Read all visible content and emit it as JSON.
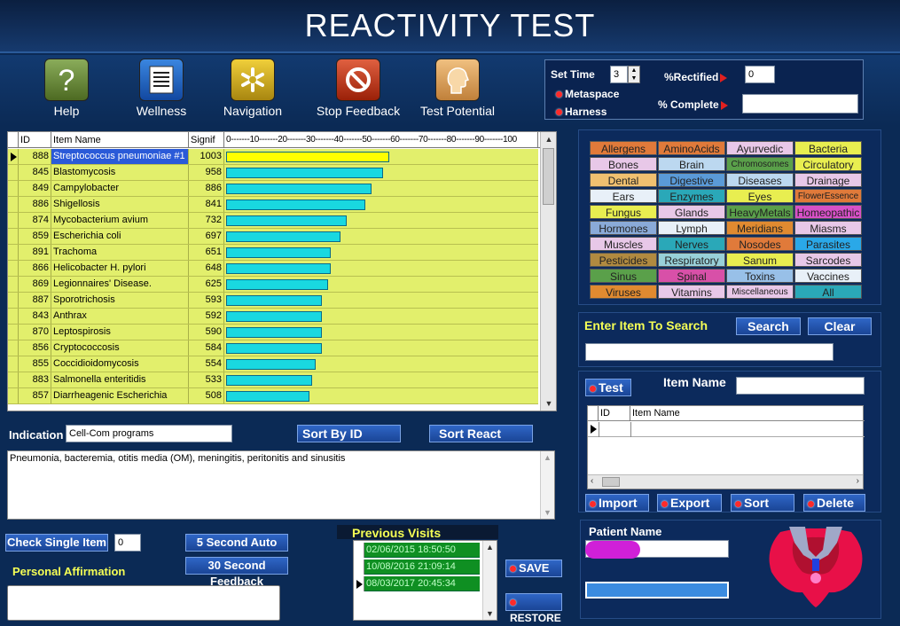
{
  "header": {
    "title": "REACTIVITY TEST"
  },
  "toolbar": [
    {
      "label": "Help",
      "icon": "question-icon",
      "color": "#6a8a3a"
    },
    {
      "label": "Wellness",
      "icon": "list-icon",
      "color": "#1d5fb8"
    },
    {
      "label": "Navigation",
      "icon": "asterisk-icon",
      "color": "#c8a81e"
    },
    {
      "label": "Stop Feedback",
      "icon": "stop-icon",
      "color": "#c43a1a"
    },
    {
      "label": "Test Potential",
      "icon": "head-icon",
      "color": "#d49a4a"
    }
  ],
  "settings": {
    "set_time_label": "Set Time",
    "set_time_value": "3",
    "metaspace_label": "Metaspace",
    "harness_label": "Harness",
    "rectified_label": "%Rectified",
    "rectified_value": "0",
    "complete_label": "% Complete",
    "complete_value": ""
  },
  "grid": {
    "columns": [
      "ID",
      "Item Name",
      "Signif",
      "0-------10-------20-------30-------40-------50-------60-------70-------80-------90-------100"
    ],
    "rows": [
      {
        "id": "888",
        "name": "Streptococcus pneumoniae #1",
        "signif": "1003",
        "pct": 53,
        "bar_color": "#ffff00",
        "selected": true
      },
      {
        "id": "845",
        "name": "Blastomycosis",
        "signif": "958",
        "pct": 51,
        "bar_color": "#19d8e0"
      },
      {
        "id": "849",
        "name": "Campylobacter",
        "signif": "886",
        "pct": 47,
        "bar_color": "#19d8e0"
      },
      {
        "id": "886",
        "name": "Shigellosis",
        "signif": "841",
        "pct": 45,
        "bar_color": "#19d8e0"
      },
      {
        "id": "874",
        "name": "Mycobacterium avium",
        "signif": "732",
        "pct": 39,
        "bar_color": "#19d8e0"
      },
      {
        "id": "859",
        "name": "Escherichia coli",
        "signif": "697",
        "pct": 37,
        "bar_color": "#19d8e0"
      },
      {
        "id": "891",
        "name": "Trachoma",
        "signif": "651",
        "pct": 34,
        "bar_color": "#19d8e0"
      },
      {
        "id": "866",
        "name": "Helicobacter H. pylori",
        "signif": "648",
        "pct": 34,
        "bar_color": "#19d8e0"
      },
      {
        "id": "869",
        "name": "Legionnaires' Disease.",
        "signif": "625",
        "pct": 33,
        "bar_color": "#19d8e0"
      },
      {
        "id": "887",
        "name": "Sporotrichosis",
        "signif": "593",
        "pct": 31,
        "bar_color": "#19d8e0"
      },
      {
        "id": "843",
        "name": "Anthrax",
        "signif": "592",
        "pct": 31,
        "bar_color": "#19d8e0"
      },
      {
        "id": "870",
        "name": "Leptospirosis",
        "signif": "590",
        "pct": 31,
        "bar_color": "#19d8e0"
      },
      {
        "id": "856",
        "name": "Cryptococcosis",
        "signif": "584",
        "pct": 31,
        "bar_color": "#19d8e0"
      },
      {
        "id": "855",
        "name": "Coccidioidomycosis",
        "signif": "554",
        "pct": 29,
        "bar_color": "#19d8e0"
      },
      {
        "id": "883",
        "name": "Salmonella enteritidis",
        "signif": "533",
        "pct": 28,
        "bar_color": "#19d8e0"
      },
      {
        "id": "857",
        "name": "Diarrheagenic Escherichia",
        "signif": "508",
        "pct": 27,
        "bar_color": "#19d8e0"
      }
    ]
  },
  "categories": [
    {
      "label": "Allergens",
      "color": "#e07a3a"
    },
    {
      "label": "AminoAcids",
      "color": "#e07a3a"
    },
    {
      "label": "Ayurvedic",
      "color": "#e8c8e8"
    },
    {
      "label": "Bacteria",
      "color": "#e8ee50"
    },
    {
      "label": "Bones",
      "color": "#e8c8e8"
    },
    {
      "label": "Brain",
      "color": "#bcd8f0"
    },
    {
      "label": "Chromosomes",
      "color": "#5aa04a"
    },
    {
      "label": "Circulatory",
      "color": "#e8ee50"
    },
    {
      "label": "Dental",
      "color": "#f0c070"
    },
    {
      "label": "Digestive",
      "color": "#5a9ad8"
    },
    {
      "label": "Diseases",
      "color": "#bcd8f0"
    },
    {
      "label": "Drainage",
      "color": "#e8c8e8"
    },
    {
      "label": "Ears",
      "color": "#e8f0f8"
    },
    {
      "label": "Enzymes",
      "color": "#2aa8b8"
    },
    {
      "label": "Eyes",
      "color": "#e8ee50"
    },
    {
      "label": "FlowerEssence",
      "color": "#e07a3a"
    },
    {
      "label": "Fungus",
      "color": "#e8ee50"
    },
    {
      "label": "Glands",
      "color": "#e8c8e8"
    },
    {
      "label": "HeavyMetals",
      "color": "#5aa04a"
    },
    {
      "label": "Homeopathic",
      "color": "#d850c8"
    },
    {
      "label": "Hormones",
      "color": "#8aaad8"
    },
    {
      "label": "Lymph",
      "color": "#e8f0f8"
    },
    {
      "label": "Meridians",
      "color": "#e08a30"
    },
    {
      "label": "Miasms",
      "color": "#e8c8e8"
    },
    {
      "label": "Muscles",
      "color": "#e8c8e8"
    },
    {
      "label": "Nerves",
      "color": "#2aa8b8"
    },
    {
      "label": "Nosodes",
      "color": "#e07a3a"
    },
    {
      "label": "Parasites",
      "color": "#2aa8e8"
    },
    {
      "label": "Pesticides",
      "color": "#b08a40"
    },
    {
      "label": "Respiratory",
      "color": "#98d0d8"
    },
    {
      "label": "Sanum",
      "color": "#e8ee50"
    },
    {
      "label": "Sarcodes",
      "color": "#e8c8e8"
    },
    {
      "label": "Sinus",
      "color": "#5aa04a"
    },
    {
      "label": "Spinal",
      "color": "#d850a8"
    },
    {
      "label": "Toxins",
      "color": "#98c0e8"
    },
    {
      "label": "Vaccines",
      "color": "#e8f0f8"
    },
    {
      "label": "Viruses",
      "color": "#e08a30"
    },
    {
      "label": "Vitamins",
      "color": "#e8c8e8"
    },
    {
      "label": "Miscellaneous",
      "color": "#e8c8e8"
    },
    {
      "label": "All",
      "color": "#2aa8b8"
    }
  ],
  "search": {
    "label": "Enter Item To Search",
    "search_btn": "Search",
    "clear_btn": "Clear",
    "value": ""
  },
  "test_panel": {
    "test_btn": "Test",
    "item_name_label": "Item Name",
    "item_name_value": "",
    "columns": [
      "ID",
      "Item Name"
    ],
    "import_btn": "Import",
    "export_btn": "Export",
    "sort_btn": "Sort",
    "delete_btn": "Delete"
  },
  "indication": {
    "label": "Indication",
    "value": "Cell-Com programs",
    "sort_id_btn": "Sort  By  ID",
    "sort_react_btn": "Sort React",
    "description": "Pneumonia, bacteremia, otitis media (OM), meningitis, peritonitis and sinusitis"
  },
  "bottom": {
    "check_single_btn": "Check Single Item",
    "check_single_value": "0",
    "five_sec_btn": "5 Second Auto",
    "thirty_sec_btn": "30 Second Feedback",
    "affirmation_label": "Personal Affirmation",
    "affirmation_value": ""
  },
  "visits": {
    "label": "Previous Visits",
    "rows": [
      "02/06/2015 18:50:50",
      "10/08/2016 21:09:14",
      "08/03/2017 20:45:34"
    ],
    "save_btn": "SAVE",
    "restore_btn": "RESTORE"
  },
  "patient": {
    "label": "Patient Name"
  }
}
